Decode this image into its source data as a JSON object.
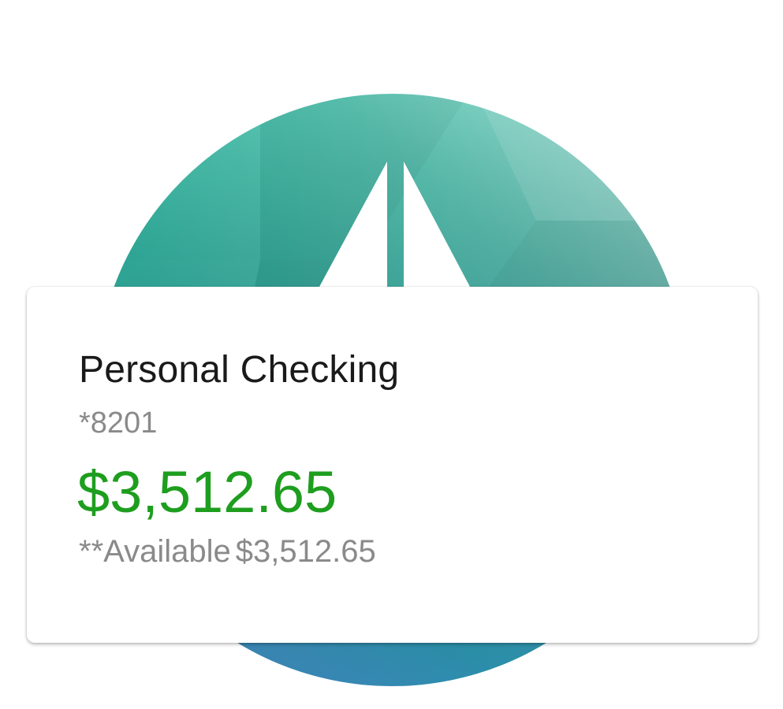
{
  "colors": {
    "accent_teal": "#17b39c",
    "accent_blue": "#4a7fc4",
    "balance_green": "#1e9e1e",
    "primary_text": "#1a1a1a",
    "secondary_text": "#8a8a8a"
  },
  "background": {
    "icon": "sailboat-emblem-icon"
  },
  "account": {
    "name": "Personal Checking",
    "number": "*8201",
    "balance": "$3,512.65",
    "available_label": "**Available",
    "available_amount": "$3,512.65"
  }
}
